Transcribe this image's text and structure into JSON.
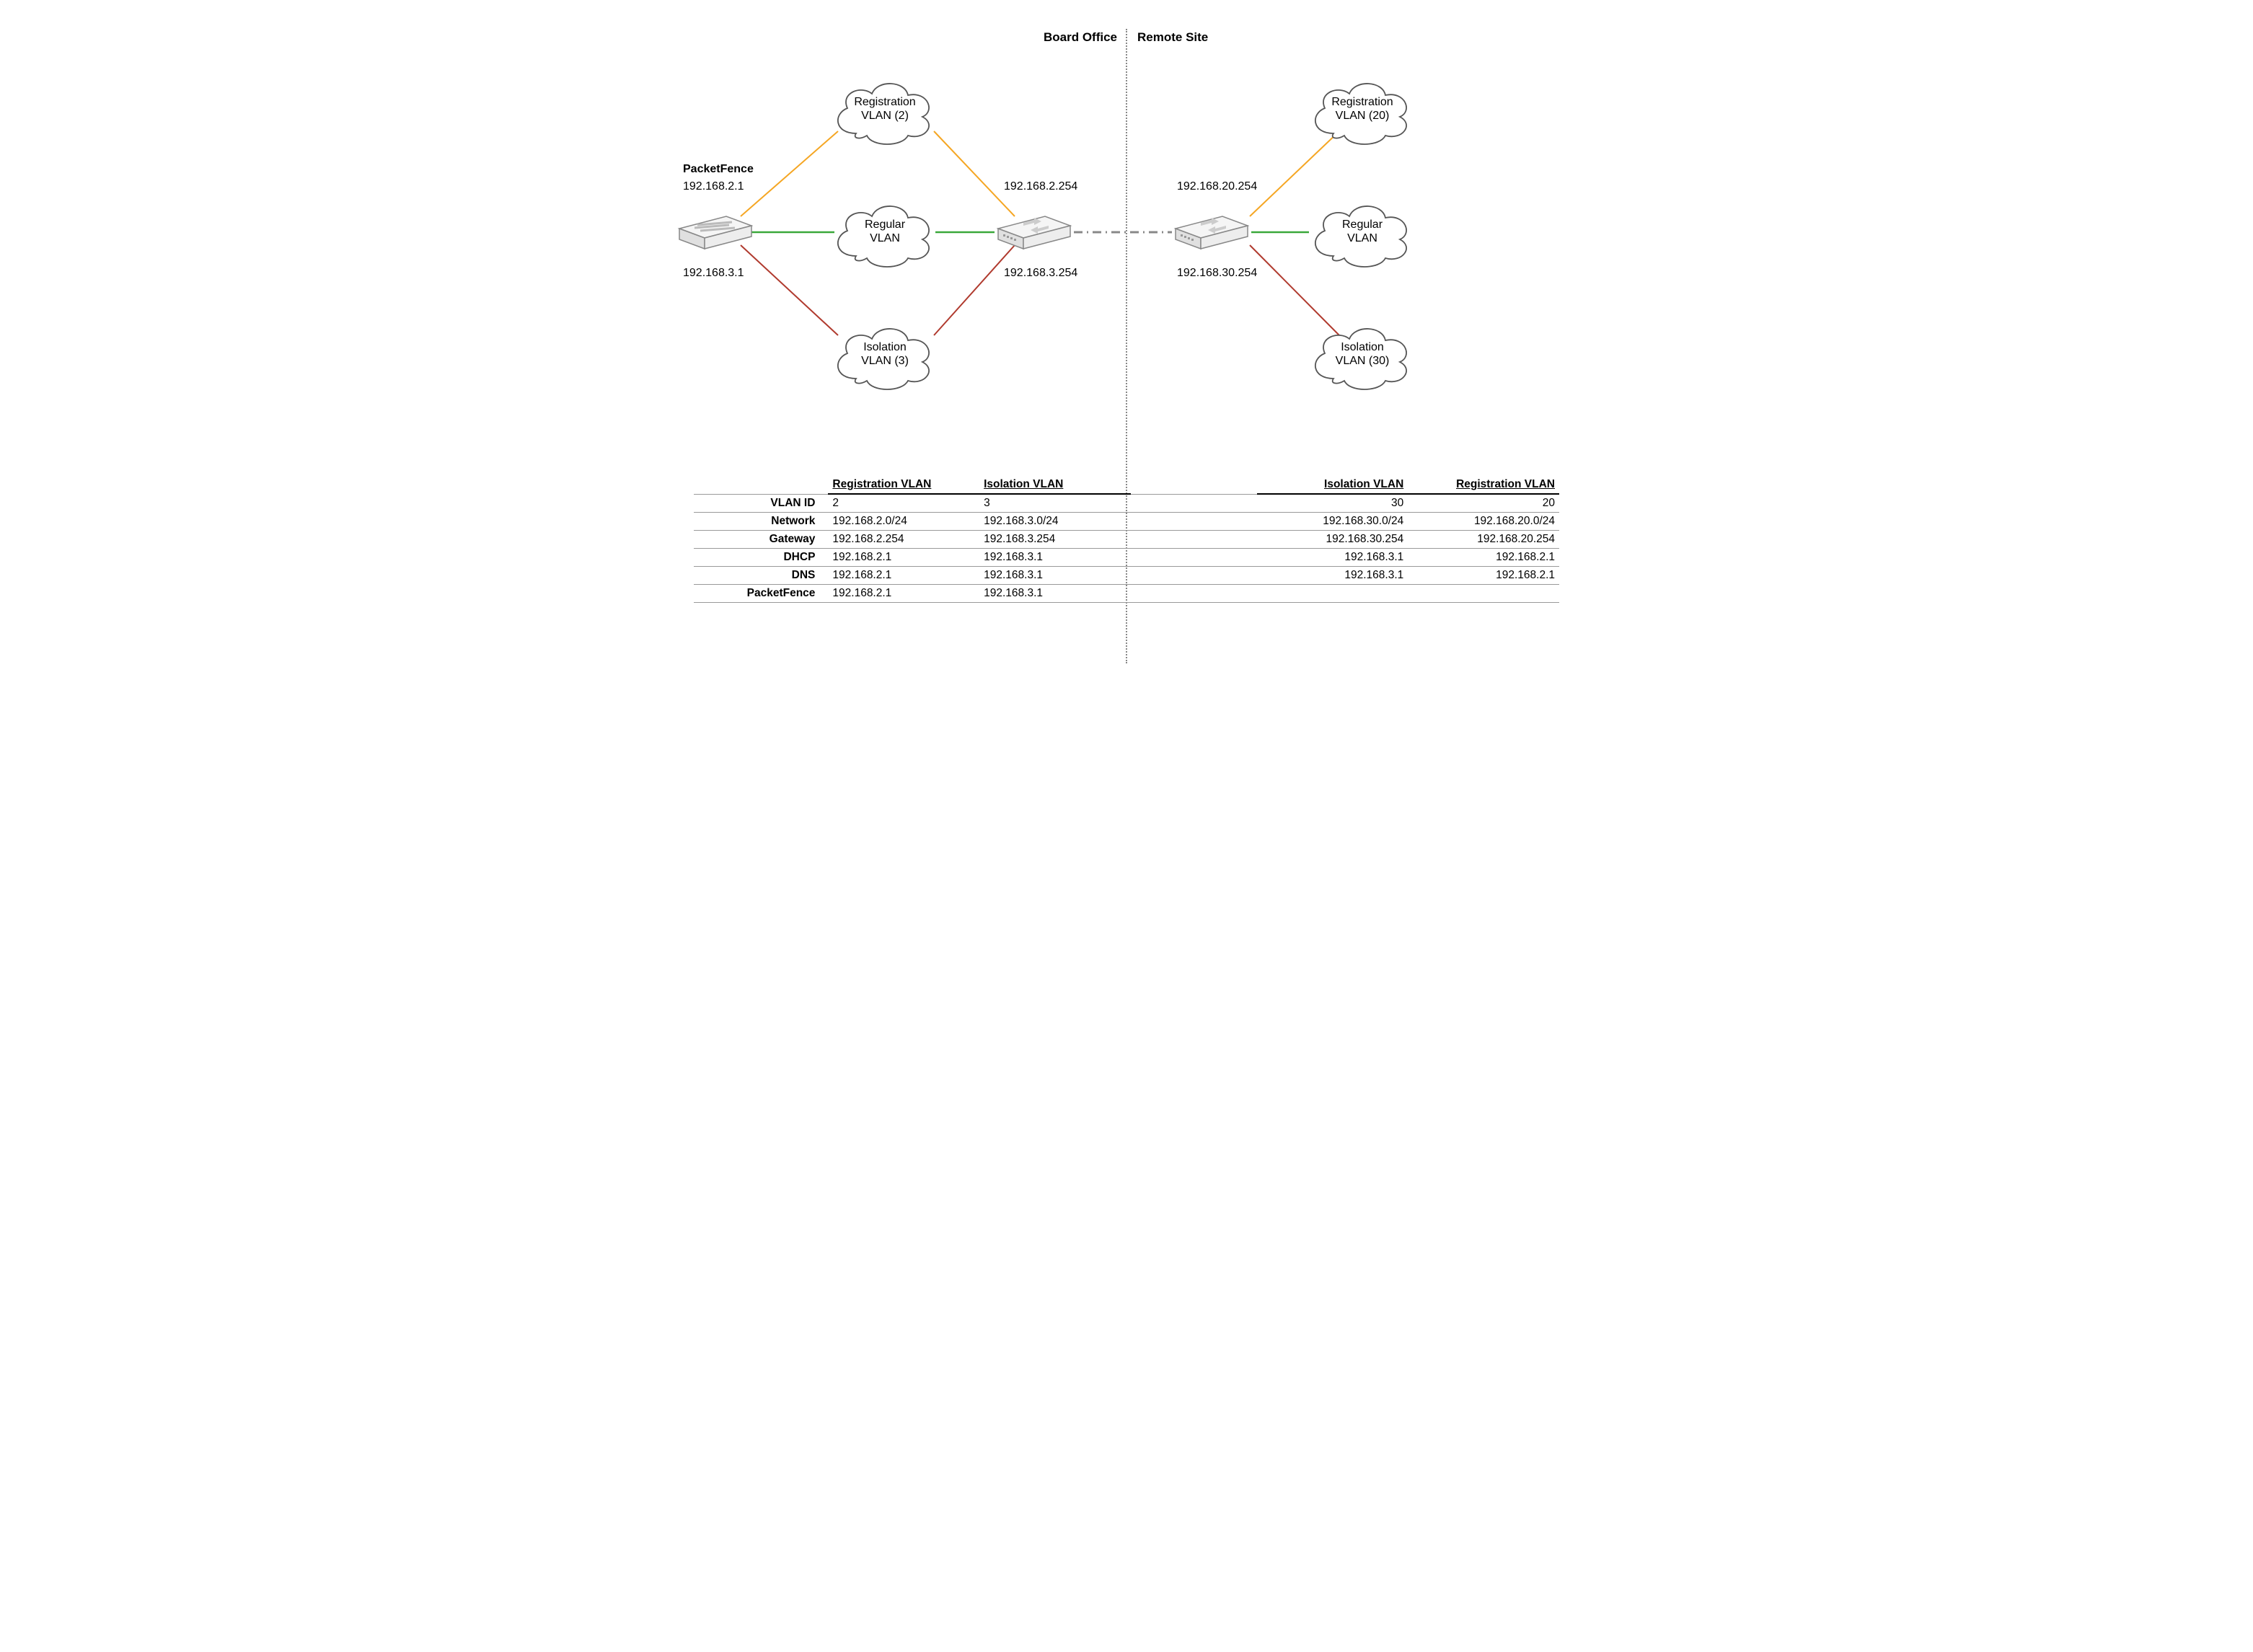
{
  "sections": {
    "left_title": "Board Office",
    "right_title": "Remote Site"
  },
  "server": {
    "title": "PacketFence",
    "ip1": "192.168.2.1",
    "ip2": "192.168.3.1"
  },
  "left_switch": {
    "ip1": "192.168.2.254",
    "ip2": "192.168.3.254"
  },
  "right_switch": {
    "ip1": "192.168.20.254",
    "ip2": "192.168.30.254"
  },
  "clouds": {
    "left_reg_l1": "Registration",
    "left_reg_l2": "VLAN (2)",
    "left_regular_l1": "Regular",
    "left_regular_l2": "VLAN",
    "left_iso_l1": "Isolation",
    "left_iso_l2": "VLAN (3)",
    "right_reg_l1": "Registration",
    "right_reg_l2": "VLAN (20)",
    "right_regular_l1": "Regular",
    "right_regular_l2": "VLAN",
    "right_iso_l1": "Isolation",
    "right_iso_l2": "VLAN (30)"
  },
  "table": {
    "headers": {
      "reg_vlan_l": "Registration VLAN",
      "iso_vlan_l": "Isolation VLAN",
      "iso_vlan_r": "Isolation VLAN",
      "reg_vlan_r": "Registration VLAN"
    },
    "rows": {
      "vlan_id": {
        "label": "VLAN ID",
        "c1": "2",
        "c2": "3",
        "c3": "30",
        "c4": "20"
      },
      "network": {
        "label": "Network",
        "c1": "192.168.2.0/24",
        "c2": "192.168.3.0/24",
        "c3": "192.168.30.0/24",
        "c4": "192.168.20.0/24"
      },
      "gateway": {
        "label": "Gateway",
        "c1": "192.168.2.254",
        "c2": "192.168.3.254",
        "c3": "192.168.30.254",
        "c4": "192.168.20.254"
      },
      "dhcp": {
        "label": "DHCP",
        "c1": "192.168.2.1",
        "c2": "192.168.3.1",
        "c3": "192.168.3.1",
        "c4": "192.168.2.1"
      },
      "dns": {
        "label": "DNS",
        "c1": "192.168.2.1",
        "c2": "192.168.3.1",
        "c3": "192.168.3.1",
        "c4": "192.168.2.1"
      },
      "packetfence": {
        "label": "PacketFence",
        "c1": "192.168.2.1",
        "c2": "192.168.3.1",
        "c3": "",
        "c4": ""
      }
    }
  },
  "colors": {
    "orange": "#f5a623",
    "green": "#3aa83a",
    "red": "#b03a2e"
  }
}
